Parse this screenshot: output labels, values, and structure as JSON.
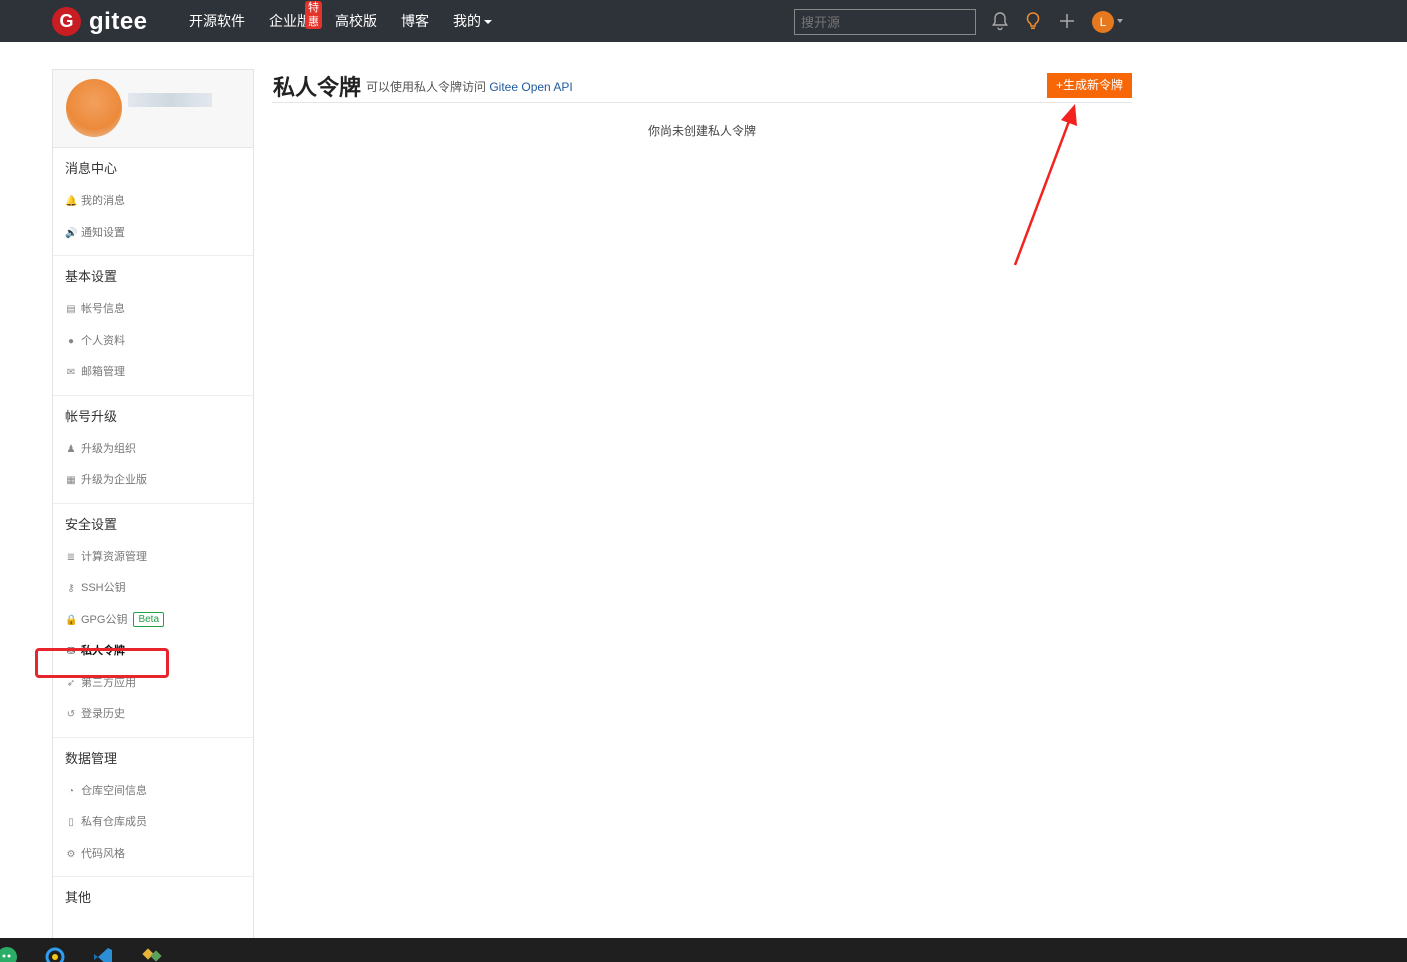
{
  "topbar": {
    "logo_badge": "G",
    "logo_text": "gitee",
    "nav": [
      {
        "label": "开源软件"
      },
      {
        "label": "企业版",
        "badge": "特惠"
      },
      {
        "label": "高校版"
      },
      {
        "label": "博客"
      },
      {
        "label": "我的"
      }
    ],
    "search_placeholder": "搜开源",
    "avatar_letter": "L"
  },
  "sidebar": {
    "groups": [
      {
        "title": "消息中心",
        "items": [
          {
            "icon": "bell-icon",
            "glyph": "🔔",
            "label": "我的消息"
          },
          {
            "icon": "speaker-icon",
            "glyph": "🔊",
            "label": "通知设置"
          }
        ]
      },
      {
        "title": "基本设置",
        "items": [
          {
            "icon": "id-card-icon",
            "glyph": "▤",
            "label": "帐号信息"
          },
          {
            "icon": "user-icon",
            "glyph": "●",
            "label": "个人资料"
          },
          {
            "icon": "mail-icon",
            "glyph": "✉",
            "label": "邮箱管理"
          }
        ]
      },
      {
        "title": "帐号升级",
        "items": [
          {
            "icon": "users-icon",
            "glyph": "♟",
            "label": "升级为组织"
          },
          {
            "icon": "building-icon",
            "glyph": "▦",
            "label": "升级为企业版"
          }
        ]
      },
      {
        "title": "安全设置",
        "items": [
          {
            "icon": "server-icon",
            "glyph": "≣",
            "label": "计算资源管理"
          },
          {
            "icon": "key-icon",
            "glyph": "⚷",
            "label": "SSH公钥"
          },
          {
            "icon": "lock-icon",
            "glyph": "🔒",
            "label": "GPG公钥",
            "badge": "Beta"
          },
          {
            "icon": "token-icon",
            "glyph": "⛁",
            "label": "私人令牌",
            "active": true
          },
          {
            "icon": "rocket-icon",
            "glyph": "➶",
            "label": "第三方应用"
          },
          {
            "icon": "history-icon",
            "glyph": "↺",
            "label": "登录历史"
          }
        ]
      },
      {
        "title": "数据管理",
        "items": [
          {
            "icon": "pie-chart-icon",
            "glyph": "◔",
            "label": "仓库空间信息"
          },
          {
            "icon": "member-icon",
            "glyph": "▯",
            "label": "私有仓库成员"
          },
          {
            "icon": "code-style-icon",
            "glyph": "⚙",
            "label": "代码风格"
          }
        ]
      },
      {
        "title": "其他",
        "items": []
      }
    ]
  },
  "main": {
    "title": "私人令牌",
    "subtitle_prefix": "可以使用私人令牌访问 ",
    "subtitle_link": "Gitee Open API",
    "new_button": "+生成新令牌",
    "empty_text": "你尚未创建私人令牌"
  },
  "colors": {
    "topbar_bg": "#2e3239",
    "brand_red": "#c71d23",
    "accent_orange": "#f76707",
    "highlight_red": "#e8252c"
  }
}
